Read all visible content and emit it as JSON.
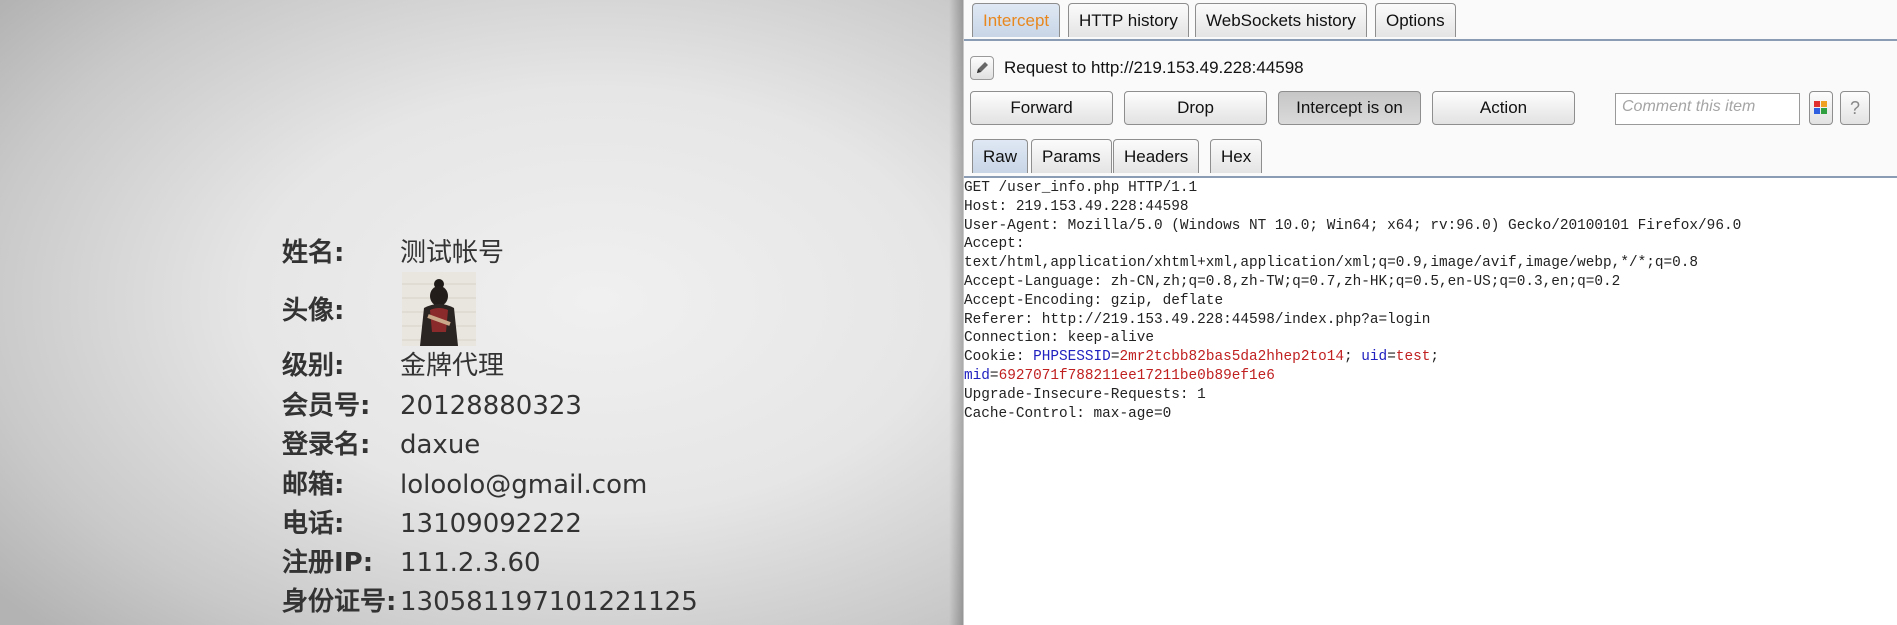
{
  "profile": {
    "rows": [
      {
        "label": "姓名:",
        "value": "测试帐号"
      },
      {
        "label": "头像:",
        "value": ""
      },
      {
        "label": "级别:",
        "value": "金牌代理"
      },
      {
        "label": "会员号:",
        "value": "20128880323"
      },
      {
        "label": "登录名:",
        "value": "daxue"
      },
      {
        "label": "邮箱:",
        "value": "loloolo@gmail.com"
      },
      {
        "label": "电话:",
        "value": "13109092222"
      },
      {
        "label": "注册IP:",
        "value": "111.2.3.60"
      },
      {
        "label": "身份证号:",
        "value": "130581197101221125"
      }
    ]
  },
  "burp": {
    "tabs": [
      "Intercept",
      "HTTP history",
      "WebSockets history",
      "Options"
    ],
    "request_label": "Request to http://219.153.49.228:44598",
    "buttons": {
      "forward": "Forward",
      "drop": "Drop",
      "intercept": "Intercept is on",
      "action": "Action"
    },
    "comment_placeholder": "Comment this item",
    "help": "?",
    "subtabs": [
      "Raw",
      "Params",
      "Headers",
      "Hex"
    ],
    "raw_lines": [
      "GET /user_info.php HTTP/1.1",
      "Host: 219.153.49.228:44598",
      "User-Agent: Mozilla/5.0 (Windows NT 10.0; Win64; x64; rv:96.0) Gecko/20100101 Firefox/96.0",
      "Accept:",
      "text/html,application/xhtml+xml,application/xml;q=0.9,image/avif,image/webp,*/*;q=0.8",
      "Accept-Language: zh-CN,zh;q=0.8,zh-TW;q=0.7,zh-HK;q=0.5,en-US;q=0.3,en;q=0.2",
      "Accept-Encoding: gzip, deflate",
      "Referer: http://219.153.49.228:44598/index.php?a=login",
      "Connection: keep-alive"
    ],
    "cookie": {
      "prefix": "Cookie: ",
      "phpsessid_name": "PHPSESSID",
      "phpsessid_value": "2mr2tcbb82bas5da2hhep2to14",
      "uid_name": "uid",
      "uid_value": "test",
      "mid_name": "mid",
      "mid_value": "6927071f788211ee17211be0b89ef1e6"
    },
    "raw_tail": [
      "Upgrade-Insecure-Requests: 1",
      "Cache-Control: max-age=0"
    ]
  }
}
